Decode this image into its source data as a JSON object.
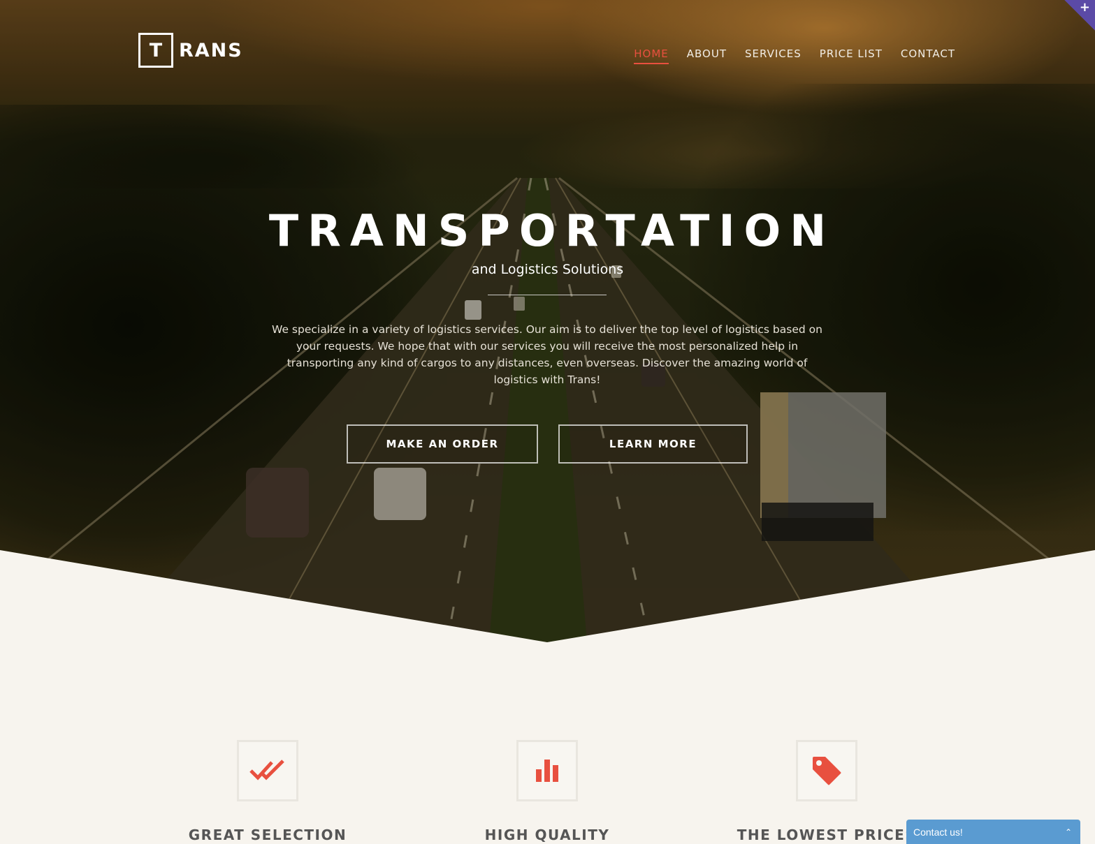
{
  "logo": {
    "box_letter": "T",
    "text": "RANS"
  },
  "nav": {
    "items": [
      {
        "label": "HOME",
        "active": true
      },
      {
        "label": "ABOUT",
        "active": false
      },
      {
        "label": "SERVICES",
        "active": false
      },
      {
        "label": "PRICE LIST",
        "active": false
      },
      {
        "label": "CONTACT",
        "active": false
      }
    ]
  },
  "hero": {
    "title": "TRANSPORTATION",
    "subtitle": "and Logistics Solutions",
    "description": "We specialize in a variety of logistics services. Our aim is to deliver the top level of logistics based on your requests. We hope that with our services you will receive the most personalized help in transporting any kind of cargos to any distances, even overseas. Discover the amazing world of logistics with Trans!",
    "buttons": {
      "order": "MAKE AN ORDER",
      "learn": "LEARN MORE"
    }
  },
  "corner": {
    "symbol": "+"
  },
  "features": [
    {
      "title": "GREAT SELECTION",
      "icon": "double-check-icon"
    },
    {
      "title": "HIGH QUALITY",
      "icon": "bar-chart-icon"
    },
    {
      "title": "THE LOWEST PRICES",
      "icon": "price-tag-icon"
    }
  ],
  "chat": {
    "label": "Contact us!",
    "chevron": "⌃"
  },
  "colors": {
    "accent": "#e8503f",
    "chat": "#5a9bd1",
    "corner": "#5b4aa6",
    "background": "#f7f4ee"
  }
}
